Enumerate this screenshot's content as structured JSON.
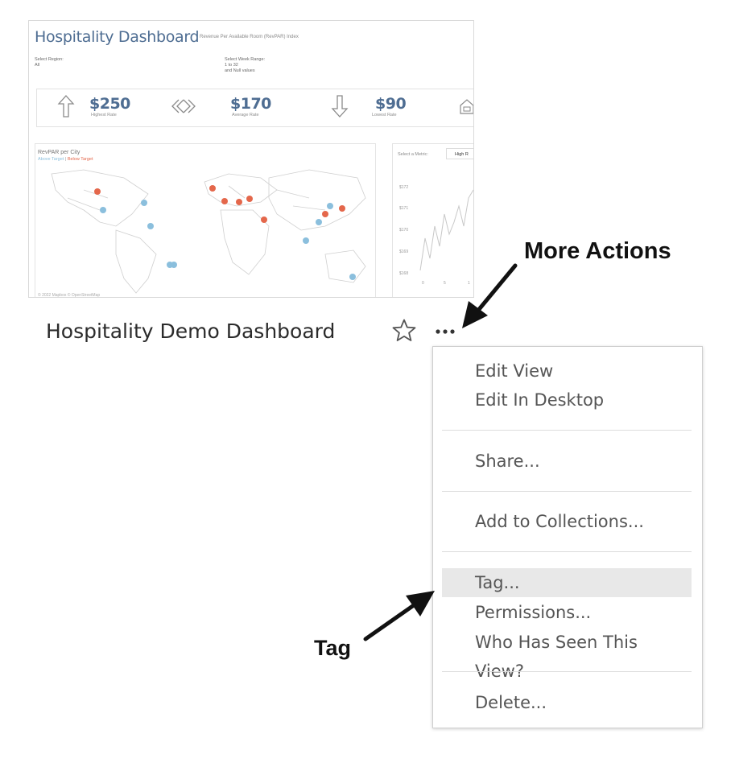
{
  "thumbnail": {
    "title": "Hospitality Dashboard",
    "subtitle": "Revenue Per Available Room (RevPAR) Index",
    "filters": {
      "region_label": "Select Region:",
      "region_value": "All",
      "week_label": "Select Week Range:",
      "week_value_1": "1 to 32",
      "week_value_2": "and Null values"
    },
    "kpis": [
      {
        "value": "$250",
        "caption": "Highest Rate"
      },
      {
        "value": "$170",
        "caption": "Average Rate"
      },
      {
        "value": "$90",
        "caption": "Lowest Rate"
      }
    ],
    "map": {
      "title": "RevPAR per City",
      "legend_above": "Above Target",
      "legend_sep": "|",
      "legend_below": "Below Target",
      "copyright": "© 2022 Mapbox © OpenStreetMap"
    },
    "metric": {
      "label": "Select a Metric:",
      "value": "High R"
    },
    "line_chart": {
      "y_ticks": [
        "$172",
        "$171",
        "$170",
        "$169",
        "$168"
      ],
      "x_ticks": [
        "0",
        "5",
        "1"
      ]
    },
    "colors": {
      "above": "#8bbfdd",
      "below": "#e4674b",
      "title": "#4e6d92"
    }
  },
  "card": {
    "title": "Hospitality Demo Dashboard",
    "star_icon": "star-outline-icon",
    "more_icon": "ellipsis-icon"
  },
  "menu": {
    "items": [
      {
        "label": "Edit View"
      },
      {
        "label": "Edit In Desktop"
      },
      {
        "label": "Share..."
      },
      {
        "label": "Add to Collections..."
      },
      {
        "label": "Tag...",
        "highlighted": true
      },
      {
        "label": "Permissions..."
      },
      {
        "label": "Who Has Seen This View?"
      },
      {
        "label": "Delete..."
      }
    ]
  },
  "annotations": {
    "more_actions": "More Actions",
    "tag": "Tag"
  }
}
